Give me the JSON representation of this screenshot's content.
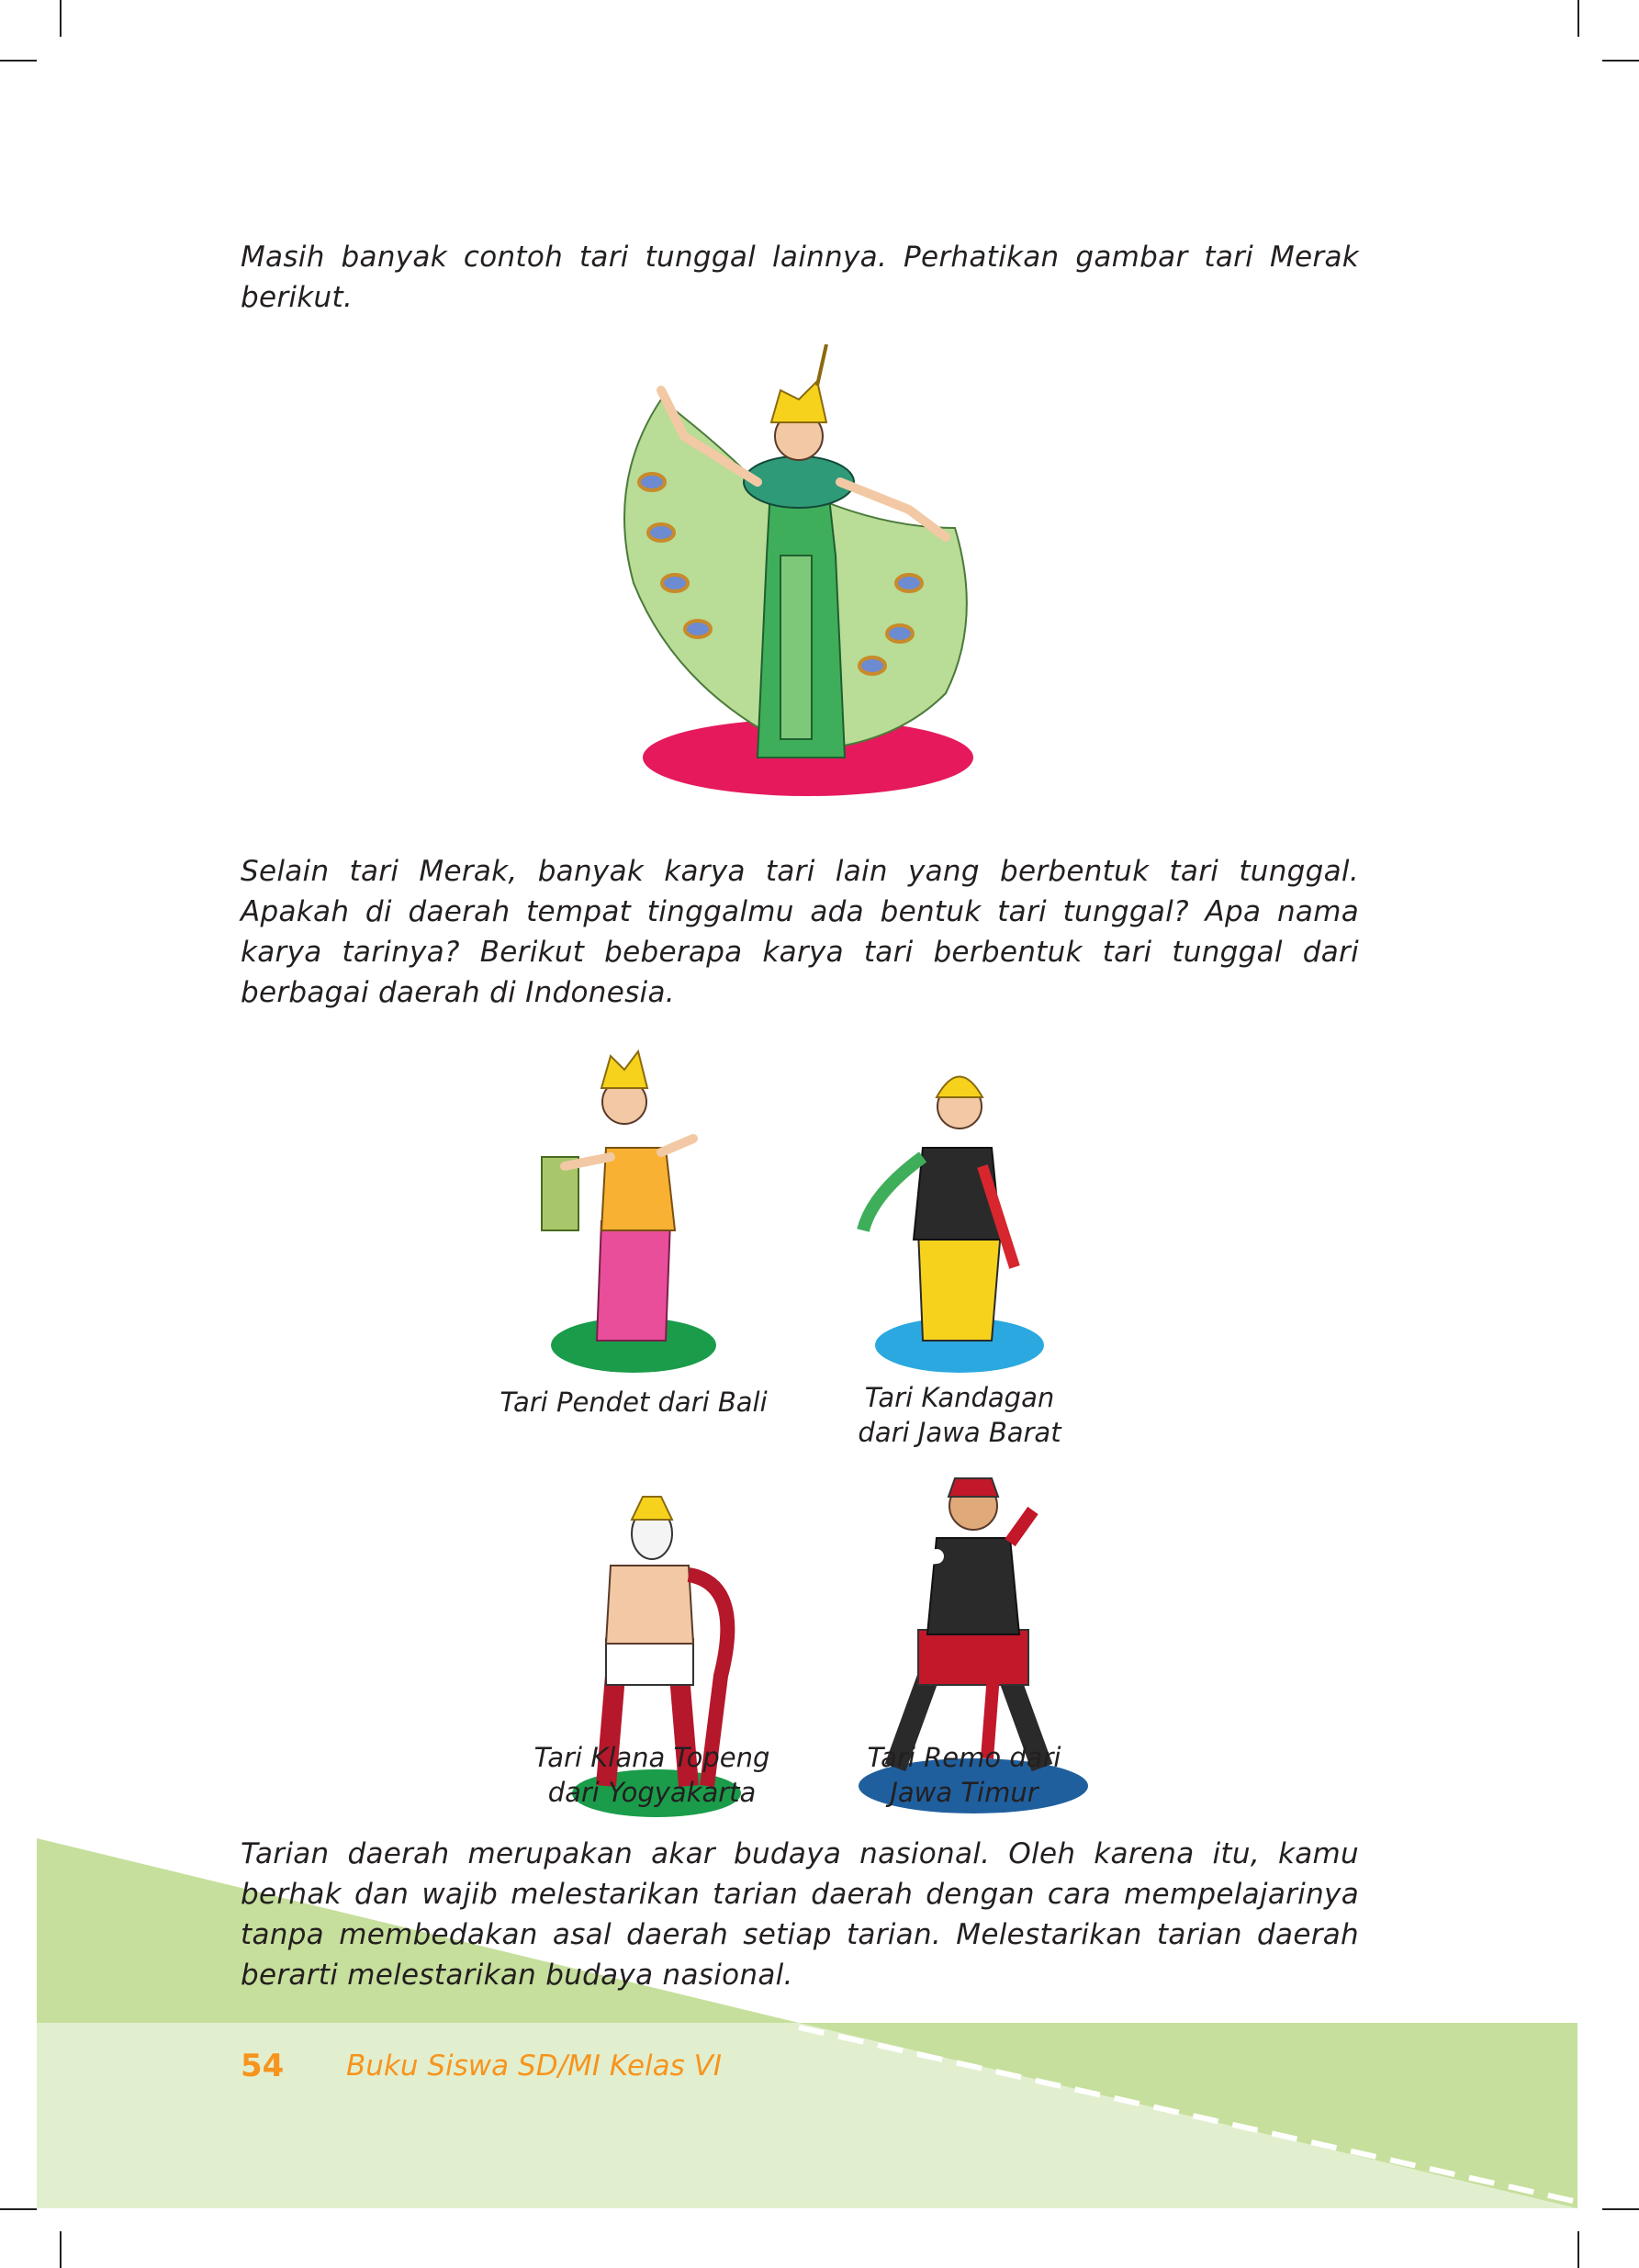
{
  "intro_text": "Masih banyak contoh tari tunggal lainnya. Perhatikan gambar tari Merak berikut.",
  "second_text": "Selain tari Merak, banyak karya tari lain yang berbentuk tari tunggal. Apakah di daerah tempat tinggalmu ada bentuk tari tunggal? Apa nama karya tarinya? Berikut beberapa karya tari berbentuk tari tunggal dari berbagai daerah di Indonesia.",
  "captions": {
    "pendet": "Tari Pendet dari Bali",
    "kandagan_1": "Tari Kandagan",
    "kandagan_2": "dari Jawa Barat",
    "klana_1": "Tari Klana Topeng",
    "klana_2": "dari Yogyakarta",
    "remo_1": "Tari Remo dari",
    "remo_2": "Jawa Timur"
  },
  "closing_text": "Tarian daerah merupakan akar budaya nasional. Oleh karena itu, kamu berhak dan wajib melestarikan tarian daerah dengan cara mempelajarinya tanpa membedakan asal daerah setiap tarian. Melestarikan tarian daerah berarti melestarikan budaya nasional.",
  "footer": {
    "page_number": "54",
    "book_title": "Buku Siswa SD/MI Kelas VI"
  },
  "colors": {
    "green_light": "#c6df9c",
    "green_pale": "#e2efcf",
    "footer_orange": "#f7941d",
    "merak_floor": "#e6195c",
    "pendet_floor": "#1a9c4a",
    "kandagan_floor": "#2aa8df",
    "klana_floor": "#1a9c4a",
    "remo_floor": "#1f5f9e"
  }
}
